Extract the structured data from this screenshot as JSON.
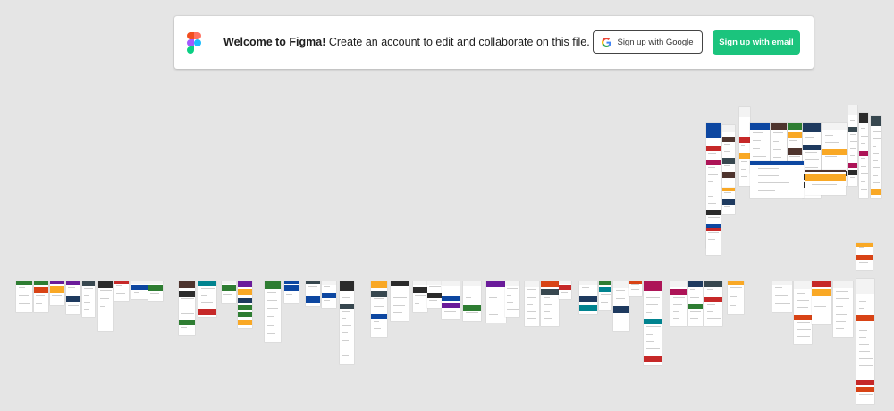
{
  "banner": {
    "welcome_bold": "Welcome to Figma!",
    "welcome_text": " Create an account to edit and collaborate on this file.",
    "google_button": "Sign up with Google",
    "email_button": "Sign up with email"
  },
  "icons": {
    "logo": "figma-logo-icon",
    "google": "google-g-icon"
  },
  "colors": {
    "canvas_bg": "#e5e5e5",
    "email_button_bg": "#1bc47d",
    "figma_red": "#f24e1e",
    "figma_orange": "#ff7262",
    "figma_purple": "#a259ff",
    "figma_blue": "#1abcfe",
    "figma_green": "#0acf83"
  }
}
